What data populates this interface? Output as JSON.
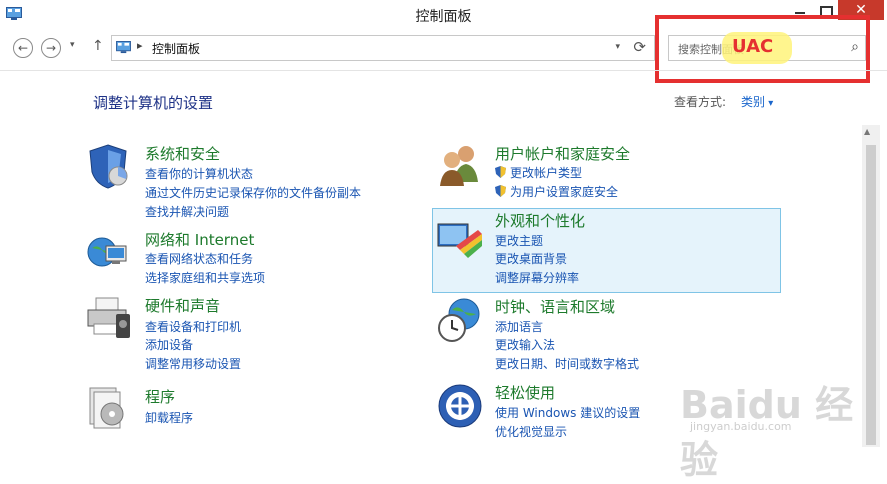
{
  "window": {
    "title": "控制面板",
    "close_glyph": "✕"
  },
  "nav": {
    "back_glyph": "←",
    "forward_glyph": "→",
    "dropdown_glyph": "▾",
    "up_glyph": "↑",
    "address_separator": "▸",
    "address_text": "控制面板",
    "address_dropdown_glyph": "▾",
    "refresh_glyph": "⟳"
  },
  "search": {
    "placeholder": "搜索控制面板",
    "icon_glyph": "⌕"
  },
  "annotation": {
    "label": "UAC",
    "box_color": "#e53030",
    "highlight_color": "#fff37a"
  },
  "content": {
    "heading": "调整计算机的设置",
    "view_by_label": "查看方式:",
    "view_by_value": "类别"
  },
  "categories": {
    "system": {
      "title": "系统和安全",
      "links": [
        "查看你的计算机状态",
        "通过文件历史记录保存你的文件备份副本",
        "查找并解决问题"
      ]
    },
    "network": {
      "title": "网络和 Internet",
      "links": [
        "查看网络状态和任务",
        "选择家庭组和共享选项"
      ]
    },
    "hardware": {
      "title": "硬件和声音",
      "links": [
        "查看设备和打印机",
        "添加设备",
        "调整常用移动设置"
      ]
    },
    "programs": {
      "title": "程序",
      "links": [
        "卸载程序"
      ]
    },
    "users": {
      "title": "用户帐户和家庭安全",
      "links": [
        "更改帐户类型",
        "为用户设置家庭安全"
      ]
    },
    "appearance": {
      "title": "外观和个性化",
      "links": [
        "更改主题",
        "更改桌面背景",
        "调整屏幕分辨率"
      ]
    },
    "clock": {
      "title": "时钟、语言和区域",
      "links": [
        "添加语言",
        "更改输入法",
        "更改日期、时间或数字格式"
      ]
    },
    "ease": {
      "title": "轻松使用",
      "links": [
        "使用 Windows 建议的设置",
        "优化视觉显示"
      ]
    }
  },
  "watermark": {
    "brand": "Baidu 经验",
    "url": "jingyan.baidu.com"
  },
  "colors": {
    "category_title": "#1d7a2c",
    "link": "#1a55b2",
    "heading": "#1e3287",
    "selected_bg": "#e5f3fb"
  }
}
